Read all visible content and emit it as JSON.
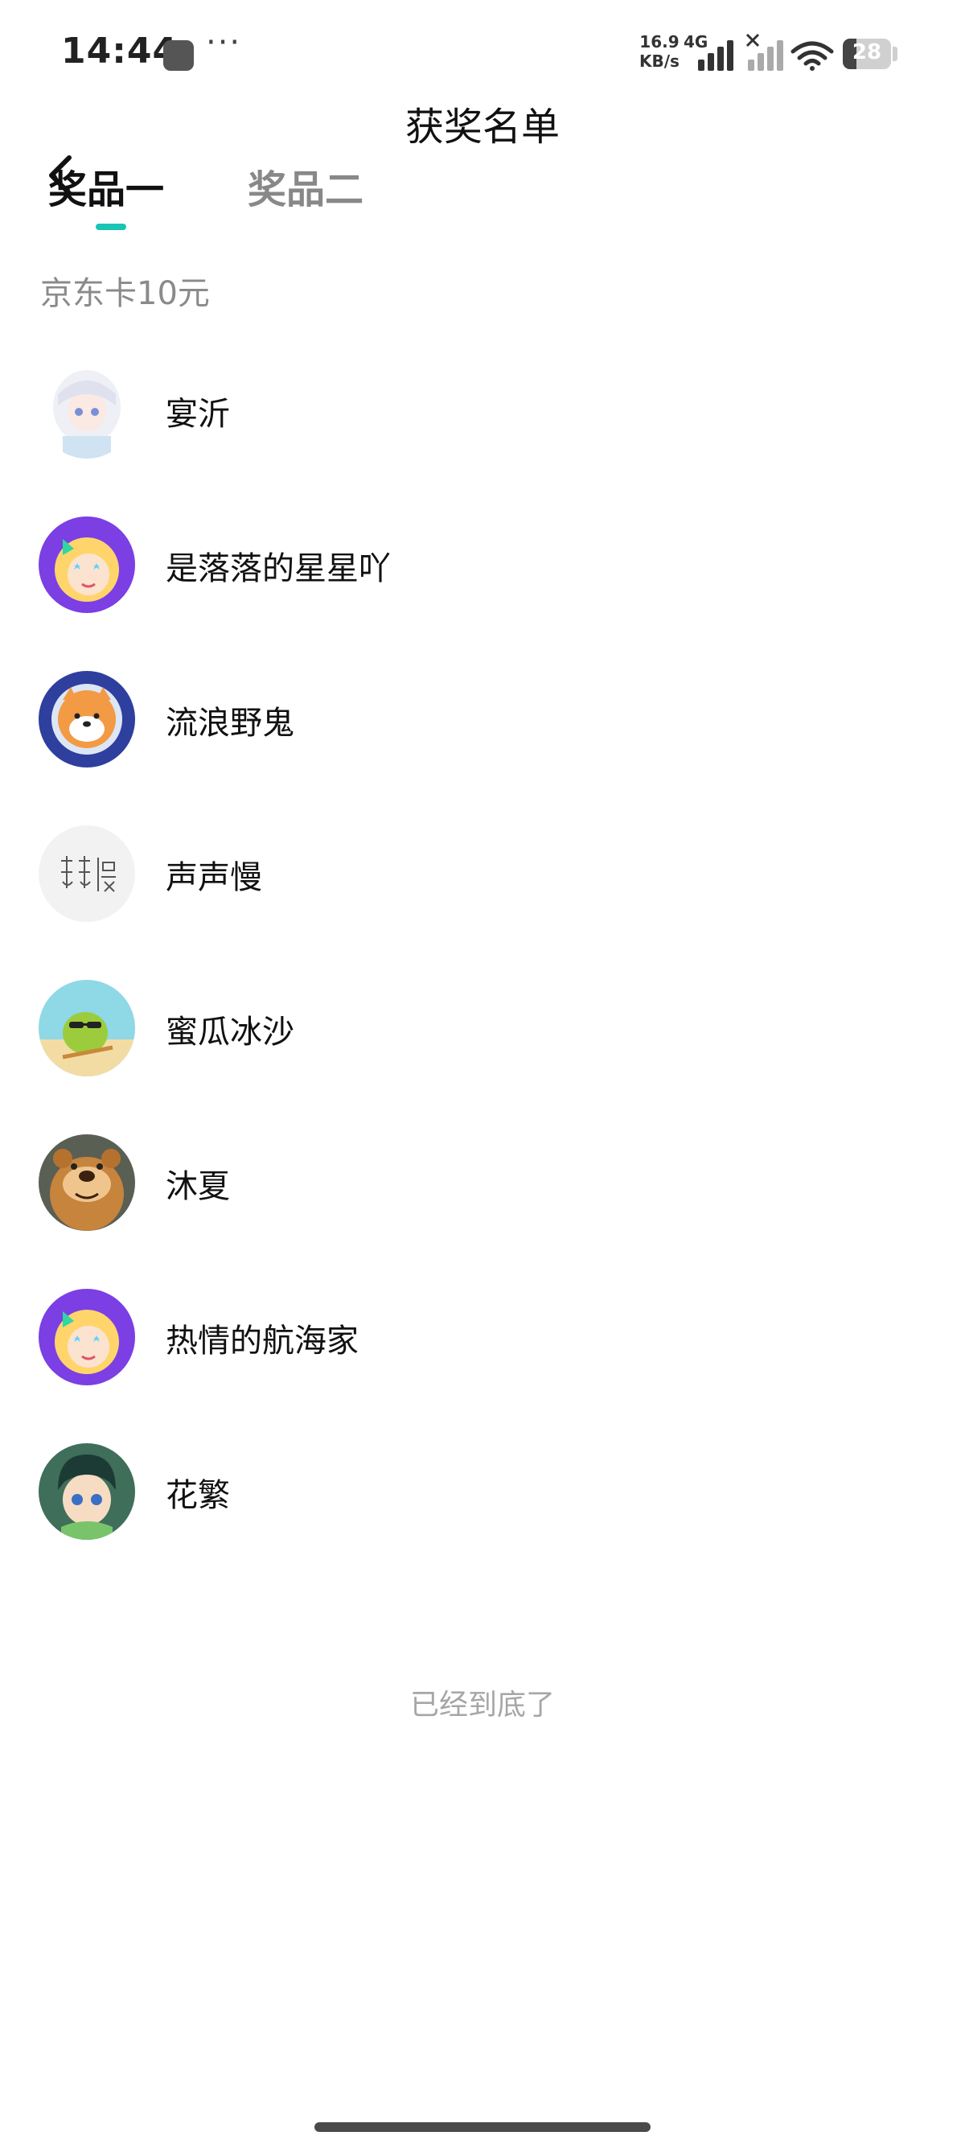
{
  "status_bar": {
    "time": "14:44",
    "more": "···",
    "speed_value": "16.9",
    "speed_unit": "KB/s",
    "network": "4G",
    "battery": "28"
  },
  "header": {
    "title": "获奖名单"
  },
  "tabs": [
    {
      "label": "奖品一",
      "active": true
    },
    {
      "label": "奖品二",
      "active": false
    }
  ],
  "prize": {
    "name": "京东卡10元"
  },
  "winners": [
    {
      "name": "宴沂",
      "avatar": "anime-girl-white-hair-avatar"
    },
    {
      "name": "是落落的星星吖",
      "avatar": "cartoon-star-eyes-avatar"
    },
    {
      "name": "流浪野鬼",
      "avatar": "shiba-dog-astronaut-avatar"
    },
    {
      "name": "声声慢",
      "avatar": "calligraphy-text-avatar"
    },
    {
      "name": "蜜瓜冰沙",
      "avatar": "melon-beach-sunglasses-avatar"
    },
    {
      "name": "沐夏",
      "avatar": "brown-bear-avatar"
    },
    {
      "name": "热情的航海家",
      "avatar": "cartoon-star-eyes-avatar"
    },
    {
      "name": "花繁",
      "avatar": "anime-boy-green-avatar"
    }
  ],
  "footer": {
    "end_text": "已经到底了"
  },
  "colors": {
    "accent": "#18c4b4",
    "muted_text": "#8a8a8a",
    "purple_avatar_bg": "#7b3fe4",
    "navy_avatar_bg": "#2e3f9e"
  }
}
